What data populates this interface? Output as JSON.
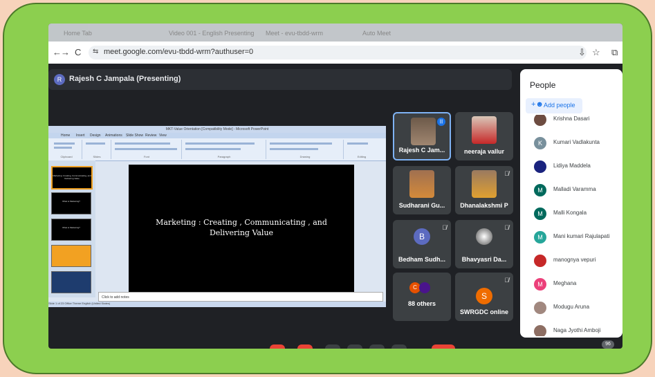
{
  "browser": {
    "tabs": [
      "Home Tab",
      "Video 001 - English Presenting",
      "Meet - evu-tbdd-wrm",
      "Auto Meet"
    ],
    "url": "meet.google.com/evu-tbdd-wrm?authuser=0",
    "nav": {
      "back": "←",
      "forward": "→",
      "reload": "C",
      "site_info": "⇆"
    },
    "right_icons": {
      "download": "⇩",
      "star": "☆",
      "extension": "⧉"
    }
  },
  "presenter": {
    "initial": "R",
    "label": "Rajesh C Jampala (Presenting)"
  },
  "powerpoint": {
    "window_title": "MKT-Value Orientation [Compatibility Mode] - Microsoft PowerPoint",
    "ribbon_tabs": [
      "Home",
      "Insert",
      "Design",
      "Animations",
      "Slide Show",
      "Review",
      "View"
    ],
    "ribbon_groups": [
      "Clipboard",
      "Slides",
      "Font",
      "Paragraph",
      "Drawing",
      "Editing"
    ],
    "slide_text_line1": "Marketing : Creating , Communicating , and",
    "slide_text_line2": "Delivering Value",
    "notes_placeholder": "Click to add notes",
    "status": "Slide 1 of 23    Office Theme    English (United States)",
    "thumbs": [
      "Marketing: Creating, Communicating, and Delivering Value",
      "What is Marketing?",
      "What is Marketing?",
      "",
      ""
    ]
  },
  "participants": [
    {
      "name": "Rajesh C Jam...",
      "type": "photo",
      "active": true,
      "mic": "|||"
    },
    {
      "name": "neeraja vallur",
      "type": "photo",
      "active": false,
      "mic": ""
    },
    {
      "name": "Sudharani Gu...",
      "type": "photo",
      "active": false,
      "mic": ""
    },
    {
      "name": "Dhanalakshmi P",
      "type": "photo",
      "active": false,
      "mic": "🎙̸"
    },
    {
      "name": "Bedham Sudh...",
      "type": "avatar",
      "initial": "B",
      "color": "#5c6bc0",
      "mic": "🎙̸"
    },
    {
      "name": "Bhavyasri Da...",
      "type": "avatar",
      "initial": "",
      "color": "#9e9e9e",
      "mic": "🎙̸"
    },
    {
      "name": "88 others",
      "type": "others",
      "initial": "C",
      "color": "#e65100",
      "mic": ""
    },
    {
      "name": "SWRGDC online",
      "type": "avatar",
      "initial": "S",
      "color": "#ef6c00",
      "mic": "🎙̸"
    }
  ],
  "people_panel": {
    "title": "People",
    "add_label": "Add people",
    "list": [
      {
        "name": "Krishna Dasari",
        "initial": "",
        "color": "#6d4c41"
      },
      {
        "name": "Kumari Vadlakunta",
        "initial": "K",
        "color": "#78909c"
      },
      {
        "name": "Lidiya Maddela",
        "initial": "",
        "color": "#1a237e"
      },
      {
        "name": "Malladi Varamma",
        "initial": "M",
        "color": "#00695c"
      },
      {
        "name": "Malli Kongala",
        "initial": "M",
        "color": "#00695c"
      },
      {
        "name": "Mani kumari Rajulapati",
        "initial": "M",
        "color": "#26a69a"
      },
      {
        "name": "manognya vepuri",
        "initial": "",
        "color": "#c62828"
      },
      {
        "name": "Meghana",
        "initial": "M",
        "color": "#ec407a"
      },
      {
        "name": "Modugu Aruna",
        "initial": "",
        "color": "#a1887f"
      },
      {
        "name": "Naga Jyothi Amboji",
        "initial": "",
        "color": "#8d6e63"
      }
    ]
  },
  "participant_count": "96"
}
